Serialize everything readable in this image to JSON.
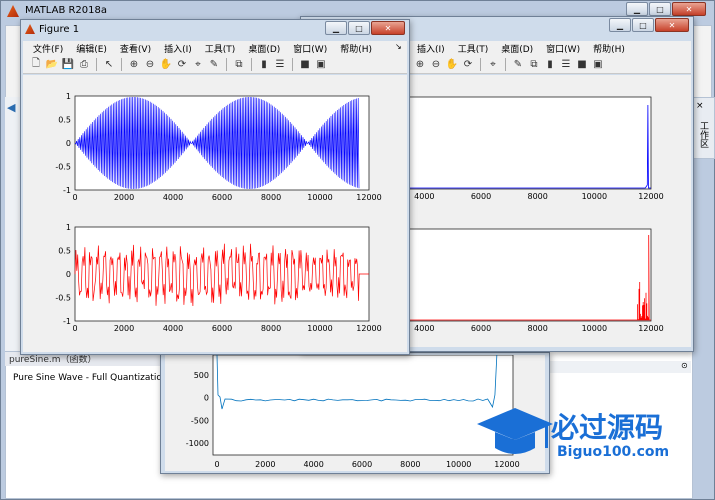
{
  "matlab": {
    "title": "MATLAB R2018a",
    "side_tab": "工作区",
    "file_title": "pureSine.m（函数）",
    "file_desc": "Pure Sine Wave - Full Quantization"
  },
  "figure1": {
    "title": "Figure 1",
    "menus": [
      "文件(F)",
      "编辑(E)",
      "查看(V)",
      "插入(I)",
      "工具(T)",
      "桌面(D)",
      "窗口(W)",
      "帮助(H)"
    ]
  },
  "figure2": {
    "menus": [
      "插入(I)",
      "工具(T)",
      "桌面(D)",
      "窗口(W)",
      "帮助(H)"
    ]
  },
  "icons": [
    "new-icon",
    "open-icon",
    "save-icon",
    "print-icon",
    "pointer-icon",
    "zoom-in-icon",
    "zoom-out-icon",
    "pan-icon",
    "rotate-icon",
    "datatip-icon",
    "brush-icon",
    "link-icon",
    "colorbar-icon",
    "legend-icon",
    "hide-plot-icon",
    "show-plot-icon"
  ],
  "colors": {
    "blue_signal": "#0000ff",
    "red_signal": "#ff0000",
    "fft_blue": "#0072bd"
  },
  "watermark": {
    "brand": "必过源码",
    "url": "Biguo100.com"
  },
  "chart_data": [
    {
      "type": "line",
      "name": "fig1-top",
      "x_ticks": [
        0,
        2000,
        4000,
        6000,
        8000,
        10000,
        12000
      ],
      "y_ticks": [
        "1",
        "0.5",
        "0",
        "-0.5",
        "-1"
      ],
      "xlim": [
        0,
        12000
      ],
      "ylim": [
        -1,
        1
      ],
      "series": [
        {
          "description": "pure sine, dense oscillation amplitude 1",
          "x_end": 11600
        }
      ]
    },
    {
      "type": "line",
      "name": "fig1-bottom",
      "x_ticks": [
        0,
        2000,
        4000,
        6000,
        8000,
        10000,
        12000
      ],
      "y_ticks": [
        "1",
        "0.5",
        "0",
        "-0.5",
        "-1"
      ],
      "xlim": [
        0,
        12000
      ],
      "ylim": [
        -1,
        1
      ],
      "series": [
        {
          "description": "quantized noisy signal amplitude ~0.6",
          "x_end": 11600
        }
      ]
    },
    {
      "type": "line",
      "name": "fig2-top",
      "x_ticks": [
        4000,
        6000,
        8000,
        10000,
        12000
      ],
      "xlim": [
        0,
        12000
      ],
      "series": [
        {
          "description": "spectrum with spike near 11900"
        }
      ]
    },
    {
      "type": "line",
      "name": "fig2-bottom",
      "x_ticks": [
        4000,
        6000,
        8000,
        10000,
        12000
      ],
      "xlim": [
        0,
        12000
      ],
      "series": [
        {
          "description": "spectrum with spikes 11400-11950"
        }
      ]
    },
    {
      "type": "line",
      "name": "fig3",
      "x_ticks": [
        0,
        2000,
        4000,
        6000,
        8000,
        10000,
        12000
      ],
      "y_ticks": [
        "500",
        "0",
        "-500",
        "-1000"
      ],
      "ylim": [
        -1000,
        1000
      ],
      "series": [
        {
          "description": "fft blue with edges spikes"
        }
      ]
    }
  ]
}
